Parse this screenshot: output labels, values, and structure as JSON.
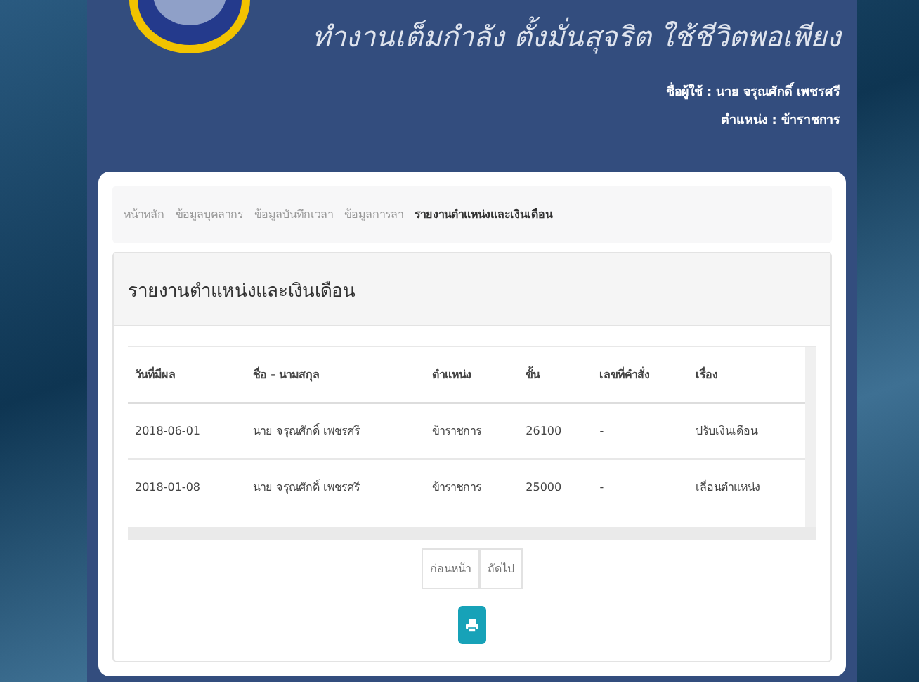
{
  "header": {
    "slogan": "ทำงานเต็มกำลัง ตั้งมั่นสุจริต ใช้ชีวิตพอเพียง",
    "user_label": "ชื่อผู้ใช้ : นาย จรุณศักดิ์ เพชรศรี",
    "position_label": "ตำแหน่ง : ข้าราชการ"
  },
  "breadcrumb": [
    {
      "label": "หน้าหลัก",
      "current": false
    },
    {
      "label": "ข้อมูลบุคลากร",
      "current": false
    },
    {
      "label": "ข้อมูลบันทึกเวลา",
      "current": false
    },
    {
      "label": "ข้อมูลการลา",
      "current": false
    },
    {
      "label": "รายงานตำแหน่งและเงินเดือน",
      "current": true
    }
  ],
  "panel": {
    "title": "รายงานตำแหน่งและเงินเดือน"
  },
  "table": {
    "columns": [
      "วันที่มีผล",
      "ชื่อ - นามสกุล",
      "ตำแหน่ง",
      "ขั้น",
      "เลขที่คำสั่ง",
      "เรื่อง"
    ],
    "rows": [
      [
        "2018-06-01",
        "นาย จรุณศักดิ์ เพชรศรี",
        "ข้าราชการ",
        "26100",
        "-",
        "ปรับเงินเดือน"
      ],
      [
        "2018-01-08",
        "นาย จรุณศักดิ์ เพชรศรี",
        "ข้าราชการ",
        "25000",
        "-",
        "เลื่อนตำแหน่ง"
      ]
    ]
  },
  "pagination": [
    "ก่อนหน้า",
    "ถัดไป"
  ]
}
